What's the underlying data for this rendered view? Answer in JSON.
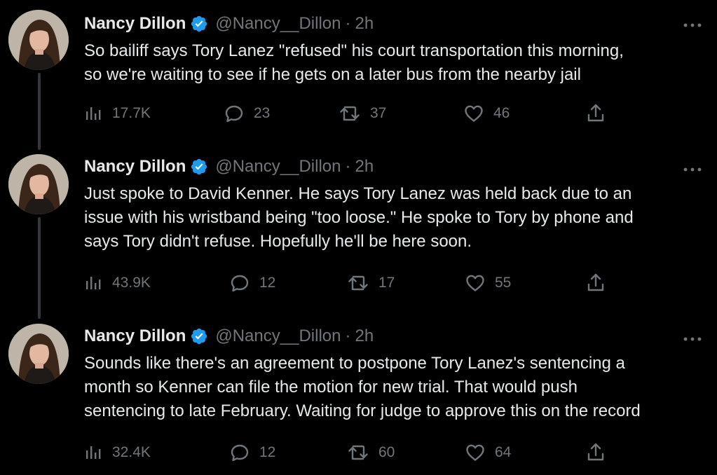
{
  "author": {
    "name": "Nancy Dillon",
    "handle": "@Nancy__Dillon",
    "separator": "·"
  },
  "colors": {
    "background": "#000000",
    "text": "#e7e9ea",
    "muted": "#71767b",
    "verified": "#1d9bf0",
    "thread_line": "#333639"
  },
  "tweets": [
    {
      "time": "2h",
      "text_lines": [
        "So bailiff says Tory Lanez \"refused\" his court transportation this morning,",
        "so we're waiting to see if he gets on a later bus from the nearby jail"
      ],
      "views": "17.7K",
      "replies": "23",
      "retweets": "37",
      "likes": "46"
    },
    {
      "time": "2h",
      "text_lines": [
        "Just spoke to David Kenner. He says Tory Lanez was held back due to an",
        "issue with his wristband being \"too loose.\" He spoke to Tory by phone and",
        "says Tory didn't refuse. Hopefully he'll be here soon."
      ],
      "views": "43.9K",
      "replies": "12",
      "retweets": "17",
      "likes": "55"
    },
    {
      "time": "2h",
      "text_lines": [
        "Sounds like there's an agreement to postpone Tory Lanez's sentencing a",
        "month so Kenner can file the motion for new trial. That would push",
        "sentencing to late February. Waiting for judge to approve this on the record"
      ],
      "views": "32.4K",
      "replies": "12",
      "retweets": "60",
      "likes": "64"
    }
  ],
  "icons": {
    "verified": "verified-badge-icon",
    "more": "more-options-icon",
    "views": "views-icon",
    "reply": "reply-icon",
    "retweet": "retweet-icon",
    "like": "like-icon",
    "share": "share-icon"
  }
}
